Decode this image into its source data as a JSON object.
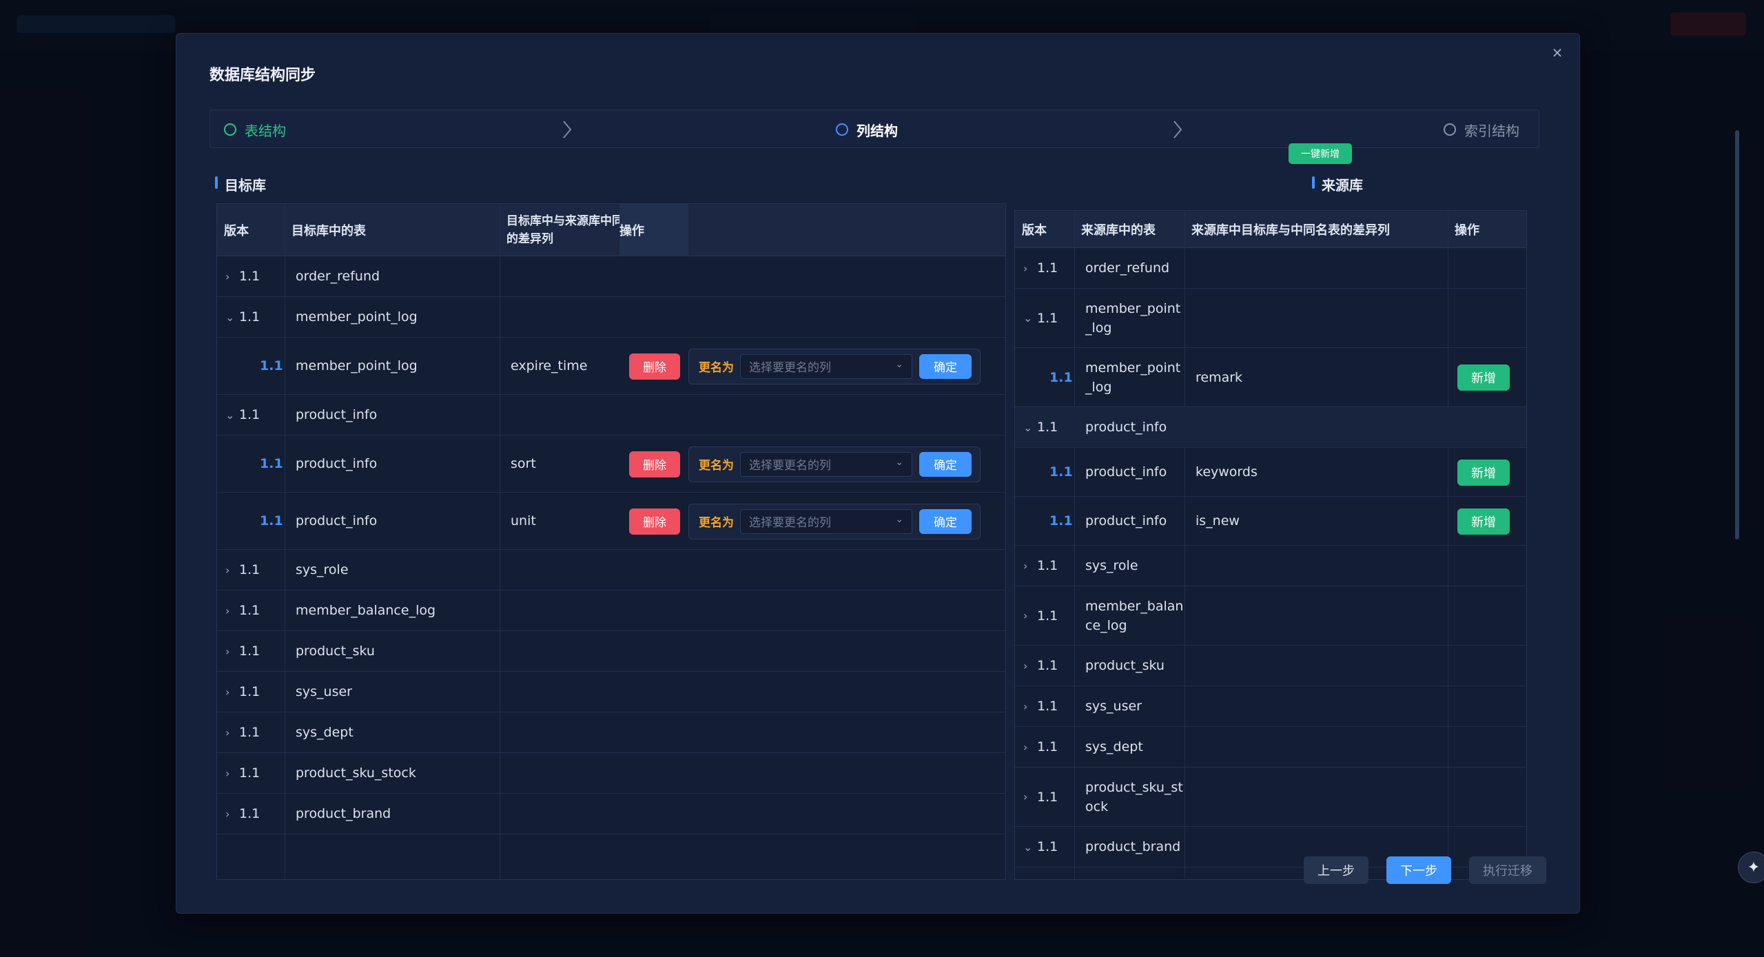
{
  "modal": {
    "title": "数据库结构同步",
    "close_label": "×"
  },
  "steps": [
    {
      "label": "表结构",
      "state": "done"
    },
    {
      "label": "列结构",
      "state": "active"
    },
    {
      "label": "索引结构",
      "state": "pending"
    }
  ],
  "target": {
    "title": "目标库",
    "headers": {
      "version": "版本",
      "table": "目标库中的表",
      "diff": "目标库中与来源库中同名表的差异列",
      "action": "操作"
    },
    "rows": [
      {
        "kind": "parent",
        "expanded": false,
        "version": "1.1",
        "table": "order_refund"
      },
      {
        "kind": "parent",
        "expanded": true,
        "version": "1.1",
        "table": "member_point_log"
      },
      {
        "kind": "child",
        "version": "1.1",
        "table": "member_point_log",
        "column": "expire_time"
      },
      {
        "kind": "parent",
        "expanded": true,
        "version": "1.1",
        "table": "product_info"
      },
      {
        "kind": "child",
        "version": "1.1",
        "table": "product_info",
        "column": "sort"
      },
      {
        "kind": "child",
        "version": "1.1",
        "table": "product_info",
        "column": "unit"
      },
      {
        "kind": "parent",
        "expanded": false,
        "version": "1.1",
        "table": "sys_role"
      },
      {
        "kind": "parent",
        "expanded": false,
        "version": "1.1",
        "table": "member_balance_log"
      },
      {
        "kind": "parent",
        "expanded": false,
        "version": "1.1",
        "table": "product_sku"
      },
      {
        "kind": "parent",
        "expanded": false,
        "version": "1.1",
        "table": "sys_user"
      },
      {
        "kind": "parent",
        "expanded": false,
        "version": "1.1",
        "table": "sys_dept"
      },
      {
        "kind": "parent",
        "expanded": false,
        "version": "1.1",
        "table": "product_sku_stock"
      },
      {
        "kind": "parent",
        "expanded": false,
        "version": "1.1",
        "table": "product_brand"
      }
    ],
    "delete_label": "删除",
    "rename_label": "更名为",
    "rename_placeholder": "选择要更名的列",
    "confirm_label": "确定"
  },
  "source": {
    "title": "来源库",
    "add_all_label": "一键新增",
    "headers": {
      "version": "版本",
      "table": "来源库中的表",
      "diff": "来源库中目标库与中同名表的差异列",
      "action": "操作"
    },
    "rows": [
      {
        "kind": "parent",
        "expanded": false,
        "version": "1.1",
        "table_lines": [
          "order_refund"
        ]
      },
      {
        "kind": "parent",
        "expanded": true,
        "version": "1.1",
        "table_lines": [
          "member_point",
          "_log"
        ]
      },
      {
        "kind": "child",
        "version": "1.1",
        "table_lines": [
          "member_point",
          "_log"
        ],
        "column": "remark"
      },
      {
        "kind": "parent",
        "expanded": true,
        "version": "1.1",
        "table_lines": [
          "product_info"
        ]
      },
      {
        "kind": "child",
        "version": "1.1",
        "table_lines": [
          "product_info"
        ],
        "column": "keywords"
      },
      {
        "kind": "child",
        "version": "1.1",
        "table_lines": [
          "product_info"
        ],
        "column": "is_new"
      },
      {
        "kind": "parent",
        "expanded": false,
        "version": "1.1",
        "table_lines": [
          "sys_role"
        ]
      },
      {
        "kind": "parent",
        "expanded": false,
        "version": "1.1",
        "table_lines": [
          "member_balan",
          "ce_log"
        ]
      },
      {
        "kind": "parent",
        "expanded": false,
        "version": "1.1",
        "table_lines": [
          "product_sku"
        ]
      },
      {
        "kind": "parent",
        "expanded": false,
        "version": "1.1",
        "table_lines": [
          "sys_user"
        ]
      },
      {
        "kind": "parent",
        "expanded": false,
        "version": "1.1",
        "table_lines": [
          "sys_dept"
        ]
      },
      {
        "kind": "parent",
        "expanded": false,
        "version": "1.1",
        "table_lines": [
          "product_sku_st",
          "ock"
        ]
      },
      {
        "kind": "parent",
        "expanded": true,
        "version": "1.1",
        "table_lines": [
          "product_brand"
        ]
      }
    ],
    "new_label": "新增"
  },
  "footer": {
    "prev_label": "上一步",
    "next_label": "下一步",
    "exec_label": "执行迁移"
  },
  "colors": {
    "primary": "#3f94ff",
    "success": "#22b97e",
    "danger": "#ef4f5e",
    "warning": "#f5a623"
  }
}
